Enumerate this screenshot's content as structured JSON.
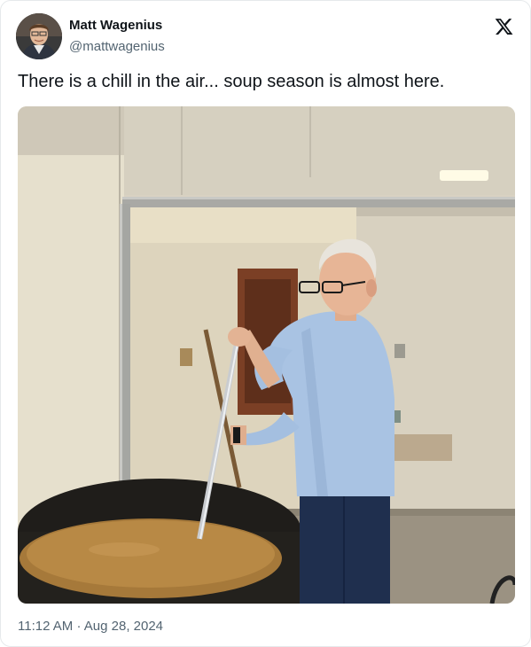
{
  "author": {
    "name": "Matt Wagenius",
    "handle": "@mattwagenius",
    "avatar_icon": "profile-photo"
  },
  "brand": {
    "logo_icon": "x-logo",
    "color": "#0f1419"
  },
  "tweet": {
    "text": "There is a chill in the air... soup season is almost here.",
    "media_description_icon": "photo-man-stirring-soup-pot"
  },
  "meta": {
    "time": "11:12 AM",
    "separator": "·",
    "date": "Aug 28, 2024"
  },
  "colors": {
    "text_primary": "#0f1419",
    "text_secondary": "#536471",
    "border": "#e6e9eb"
  }
}
